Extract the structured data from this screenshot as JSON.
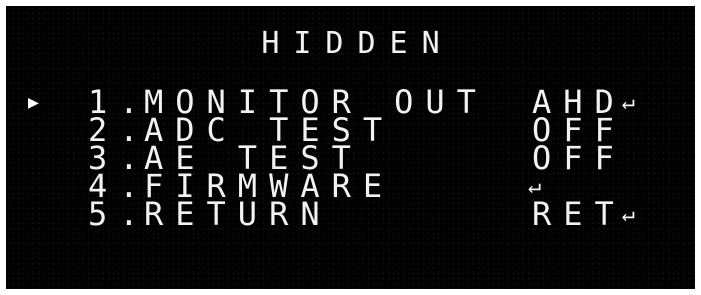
{
  "title": "HIDDEN",
  "cursor_icon": "pointer-triangle-icon",
  "items": [
    {
      "number": "1.",
      "label": "MONITOR OUT",
      "value": "AHD",
      "enter": "↵"
    },
    {
      "number": "2.",
      "label": "ADC TEST",
      "value": "OFF",
      "enter": ""
    },
    {
      "number": "3.",
      "label": "AE TEST",
      "value": "OFF",
      "enter": ""
    },
    {
      "number": "4.",
      "label": "FIRMWARE",
      "value": "",
      "enter": "↵"
    },
    {
      "number": "5.",
      "label": "RETURN",
      "value": "RET",
      "enter": "↵"
    }
  ],
  "colors": {
    "background": "#000000",
    "text": "#f2f2f2"
  }
}
